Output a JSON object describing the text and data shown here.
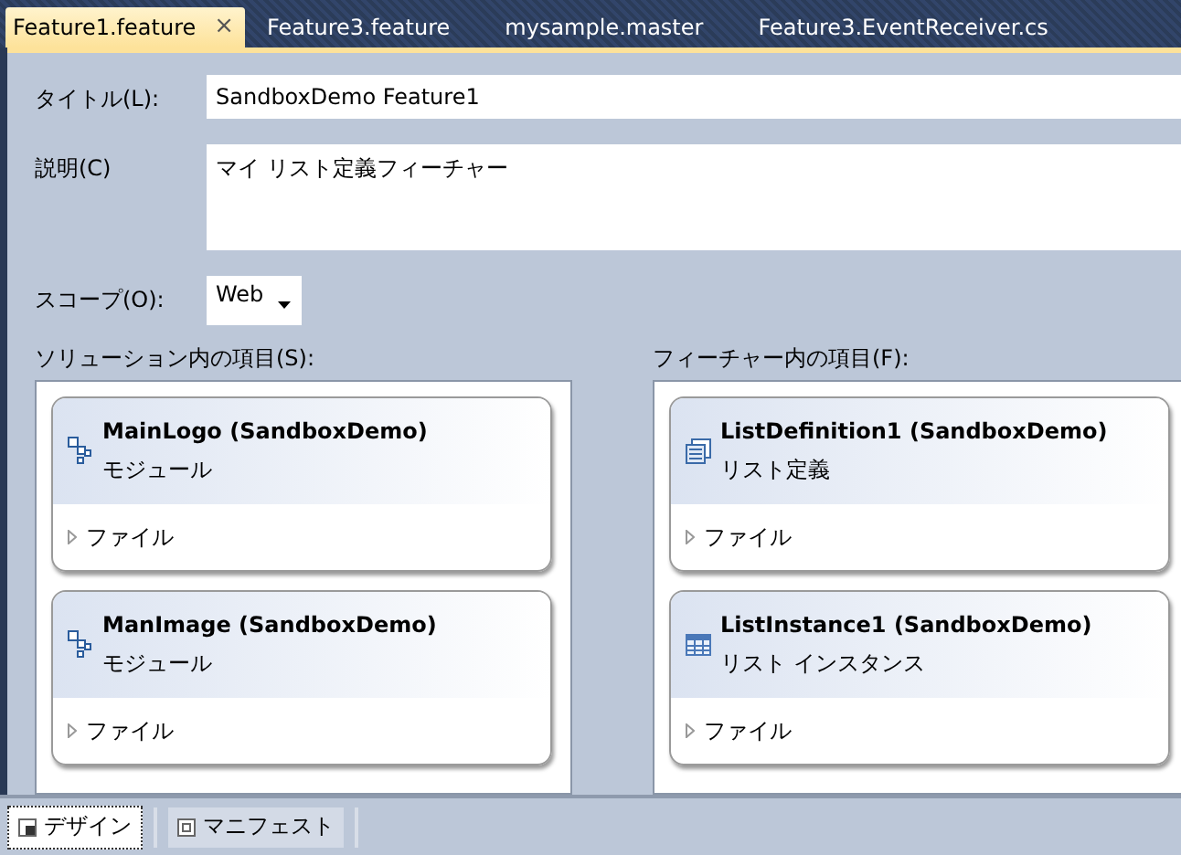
{
  "tabs": [
    {
      "label": "Feature1.feature",
      "selected": true,
      "close": "×"
    },
    {
      "label": "Feature3.feature",
      "selected": false
    },
    {
      "label": "mysample.master",
      "selected": false
    },
    {
      "label": "Feature3.EventReceiver.cs",
      "selected": false
    }
  ],
  "title_field": {
    "label": "タイトル(L):",
    "value": "SandboxDemo Feature1"
  },
  "description_field": {
    "label": "説明(C)",
    "value": "マイ リスト定義フィーチャー"
  },
  "scope_field": {
    "label": "スコープ(O):",
    "value": "Web"
  },
  "solution_items": {
    "label": "ソリューション内の項目(S):",
    "items": [
      {
        "name": "MainLogo (SandboxDemo)",
        "type": "モジュール",
        "kind": "module",
        "files": "ファイル"
      },
      {
        "name": "ManImage (SandboxDemo)",
        "type": "モジュール",
        "kind": "module",
        "files": "ファイル"
      }
    ]
  },
  "feature_items": {
    "label": "フィーチャー内の項目(F):",
    "items": [
      {
        "name": "ListDefinition1 (SandboxDemo)",
        "type": "リスト定義",
        "kind": "list-definition",
        "files": "ファイル"
      },
      {
        "name": "ListInstance1 (SandboxDemo)",
        "type": "リスト インスタンス",
        "kind": "list-instance",
        "files": "ファイル"
      }
    ]
  },
  "view_tabs": [
    {
      "label": "デザイン",
      "selected": true,
      "kind": "design"
    },
    {
      "label": "マニフェスト",
      "selected": false,
      "kind": "manifest"
    }
  ]
}
